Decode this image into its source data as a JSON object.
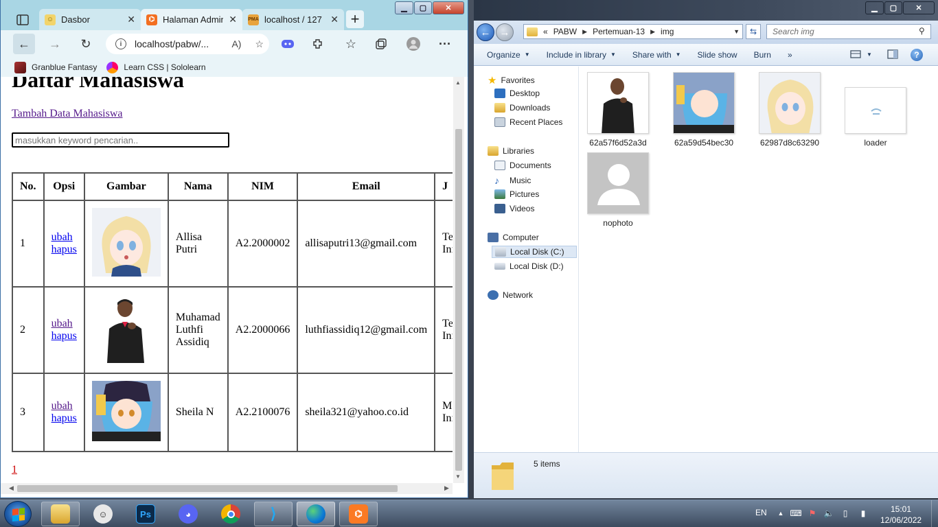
{
  "browser": {
    "tabs": [
      {
        "title": "Dasbor",
        "state": "inactive",
        "icon": "smiley-favicon-icon"
      },
      {
        "title": "Halaman Admin",
        "state": "active",
        "icon": "html-favicon-icon"
      },
      {
        "title": "localhost / 127",
        "state": "inactive",
        "icon": "phpmyadmin-favicon-icon"
      }
    ],
    "address": "localhost/pabw/...",
    "bookmarks": [
      "Granblue Fantasy",
      "Learn CSS | Sololearn"
    ]
  },
  "page": {
    "heading": "Daftar Mahasiswa",
    "add_link": "Tambah Data Mahasiswa",
    "search_placeholder": "masukkan keyword pencarian..",
    "columns": [
      "No.",
      "Opsi",
      "Gambar",
      "Nama",
      "NIM",
      "Email",
      "J"
    ],
    "rows": [
      {
        "no": "1",
        "edit": "ubah",
        "delete": "hapus",
        "name": "Allisa Putri",
        "nim": "A2.2000002",
        "email": "allisaputri13@gmail.com",
        "jurusan": "Te Inf"
      },
      {
        "no": "2",
        "edit": "ubah",
        "delete": "hapus",
        "name": "Muhamad Luthfi Assidiq",
        "nim": "A2.2000066",
        "email": "luthfiassidiq12@gmail.com",
        "jurusan": "Te Inf"
      },
      {
        "no": "3",
        "edit": "ubah",
        "delete": "hapus",
        "name": "Sheila N",
        "nim": "A2.2100076",
        "email": "sheila321@yahoo.co.id",
        "jurusan": "M Inf"
      }
    ],
    "pagination": [
      "1"
    ]
  },
  "explorer": {
    "breadcrumb": [
      "«",
      "PABW",
      "Pertemuan-13",
      "img"
    ],
    "search_placeholder": "Search img",
    "commands": [
      "Organize",
      "Include in library",
      "Share with",
      "Slide show",
      "Burn",
      "»"
    ],
    "nav": {
      "favorites_label": "Favorites",
      "favorites": [
        "Desktop",
        "Downloads",
        "Recent Places"
      ],
      "libraries_label": "Libraries",
      "libraries": [
        "Documents",
        "Music",
        "Pictures",
        "Videos"
      ],
      "computer_label": "Computer",
      "drives": [
        "Local Disk (C:)",
        "Local Disk (D:)"
      ],
      "network_label": "Network"
    },
    "files": [
      "62a57f6d52a3d",
      "62a59d54bec30",
      "62987d8c63290",
      "loader",
      "nophoto"
    ],
    "item_count": "5 items"
  },
  "taskbar": {
    "apps": [
      "start",
      "file-explorer",
      "app-face",
      "photoshop",
      "discord",
      "chrome",
      "vscode",
      "edge",
      "xampp"
    ],
    "language": "EN",
    "time": "15:01",
    "date": "12/06/2022"
  },
  "colors": {
    "edge_tabbar": "#a9d6e4",
    "edge_toolbar": "#e9f4f8",
    "link_visited": "#551a8b",
    "link": "#0000ee",
    "pager": "#cc0000"
  }
}
